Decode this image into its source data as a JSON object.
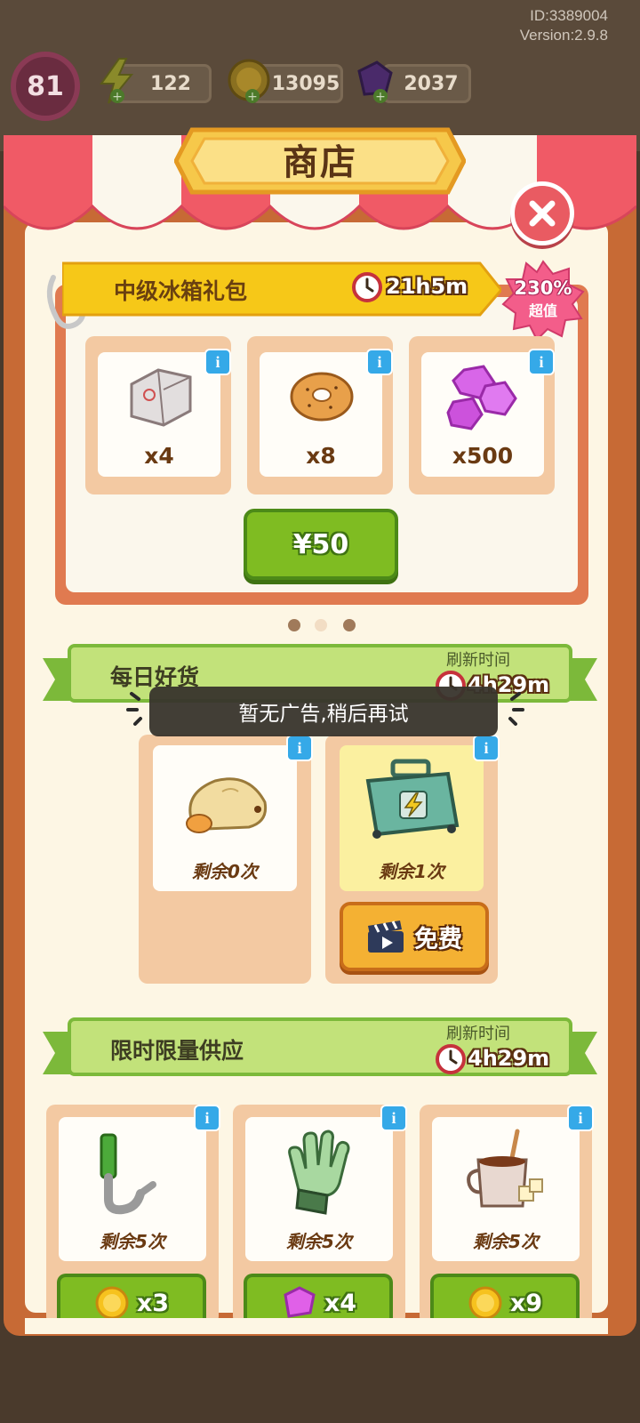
{
  "account": {
    "id_label": "ID:3389004",
    "version_label": "Version:2.9.8"
  },
  "player": {
    "level": "81"
  },
  "resources": {
    "energy": "122",
    "coins": "13095",
    "gems": "2037"
  },
  "shop": {
    "title": "商店"
  },
  "pack": {
    "name": "中级冰箱礼包",
    "timer": "21h5m",
    "value_percent": "230%",
    "value_label": "超值",
    "items": [
      {
        "icon": "fridge-icon",
        "qty": "x4"
      },
      {
        "icon": "bagel-icon",
        "qty": "x8"
      },
      {
        "icon": "gems-icon",
        "qty": "x500"
      }
    ],
    "price": "¥50",
    "page_indicator": {
      "count": 3,
      "active": 1
    }
  },
  "daily": {
    "title": "每日好货",
    "refresh_label": "刷新时间",
    "timer": "4h29m",
    "items": [
      {
        "icon": "dough-icon",
        "remaining": "剩余0次"
      },
      {
        "icon": "energy-toolbox-icon",
        "remaining": "剩余1次",
        "button": "免费"
      }
    ]
  },
  "toast": {
    "message": "暂无广告,稍后再试"
  },
  "limited": {
    "title": "限时限量供应",
    "refresh_label": "刷新时间",
    "timer": "4h29m",
    "items": [
      {
        "icon": "pipe-wrench-icon",
        "remaining": "剩余5次",
        "cost_icon": "coin-icon",
        "cost": "x3"
      },
      {
        "icon": "glove-icon",
        "remaining": "剩余5次",
        "cost_icon": "gem-icon",
        "cost": "x4"
      },
      {
        "icon": "hot-chocolate-icon",
        "remaining": "剩余5次",
        "cost_icon": "coin-icon",
        "cost": "x9"
      }
    ]
  },
  "colors": {
    "frame": "#c76a35",
    "panel_bg": "#fdf6e4",
    "green_button": "#7fbc22",
    "orange_button": "#f4b133",
    "awning_red": "#f05a66",
    "info_blue": "#35a9e8"
  }
}
